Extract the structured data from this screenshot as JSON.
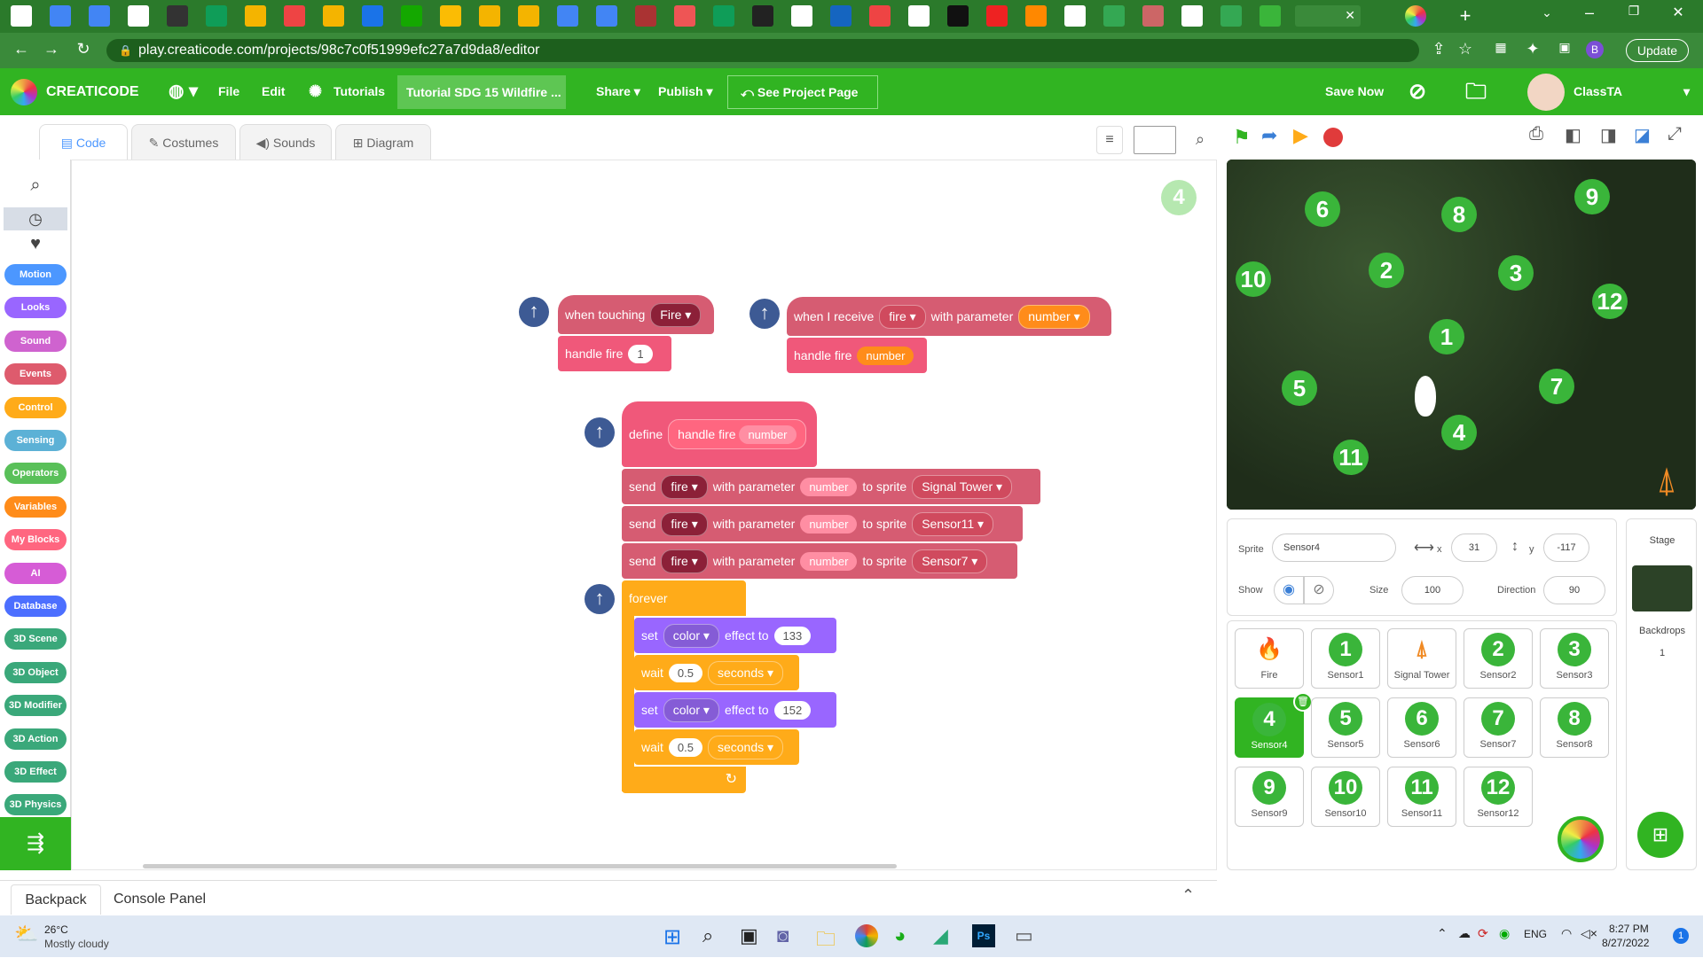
{
  "browser": {
    "url": "play.creaticode.com/projects/98c7c0f51999efc27a7d9da8/editor",
    "update_label": "Update",
    "profile_initial": "B"
  },
  "app": {
    "brand": "CREATICODE",
    "menu": {
      "file": "File",
      "edit": "Edit",
      "tutorials": "Tutorials",
      "share": "Share",
      "publish": "Publish",
      "see_project": "See Project Page"
    },
    "project_title": "Tutorial SDG 15 Wildfire ...",
    "save_now": "Save Now",
    "user": "ClassTA"
  },
  "tabs": {
    "code": "Code",
    "costumes": "Costumes",
    "sounds": "Sounds",
    "diagram": "Diagram"
  },
  "categories": [
    {
      "label": "Motion",
      "color": "#4c97ff"
    },
    {
      "label": "Looks",
      "color": "#9966ff"
    },
    {
      "label": "Sound",
      "color": "#cf63cf"
    },
    {
      "label": "Events",
      "color": "#de5b6d"
    },
    {
      "label": "Control",
      "color": "#ffab19"
    },
    {
      "label": "Sensing",
      "color": "#5cb1d6"
    },
    {
      "label": "Operators",
      "color": "#59c059"
    },
    {
      "label": "Variables",
      "color": "#ff8c1a"
    },
    {
      "label": "My Blocks",
      "color": "#ff6680"
    },
    {
      "label": "AI",
      "color": "#d65cd6"
    },
    {
      "label": "Database",
      "color": "#4c6fff"
    },
    {
      "label": "3D Scene",
      "color": "#3aa87a"
    },
    {
      "label": "3D Object",
      "color": "#3aa87a"
    },
    {
      "label": "3D Modifier",
      "color": "#3aa87a"
    },
    {
      "label": "3D Action",
      "color": "#3aa87a"
    },
    {
      "label": "3D Effect",
      "color": "#3aa87a"
    },
    {
      "label": "3D Physics",
      "color": "#3aa87a"
    }
  ],
  "code": {
    "sprite_badge": "4",
    "hat1": {
      "text": "when touching",
      "dropdown": "Fire"
    },
    "call1": {
      "text": "handle fire",
      "arg": "1"
    },
    "hat2": {
      "text": "when I receive",
      "dropdown": "fire",
      "with": "with parameter",
      "param": "number"
    },
    "call2": {
      "text": "handle fire",
      "arg": "number"
    },
    "define": {
      "text": "define",
      "name": "handle fire",
      "param": "number"
    },
    "send1": {
      "send": "send",
      "msg": "fire",
      "with": "with parameter",
      "param": "number",
      "to": "to sprite",
      "target": "Signal Tower"
    },
    "send2": {
      "send": "send",
      "msg": "fire",
      "with": "with parameter",
      "param": "number",
      "to": "to sprite",
      "target": "Sensor11"
    },
    "send3": {
      "send": "send",
      "msg": "fire",
      "with": "with parameter",
      "param": "number",
      "to": "to sprite",
      "target": "Sensor7"
    },
    "forever": "forever",
    "set1": {
      "set": "set",
      "effect": "color",
      "to": "effect to",
      "value": "133"
    },
    "wait1": {
      "wait": "wait",
      "value": "0.5",
      "unit": "seconds"
    },
    "set2": {
      "set": "set",
      "effect": "color",
      "to": "effect to",
      "value": "152"
    },
    "wait2": {
      "wait": "wait",
      "value": "0.5",
      "unit": "seconds"
    }
  },
  "bottom": {
    "backpack": "Backpack",
    "console": "Console Panel"
  },
  "stage_numbers": [
    "6",
    "8",
    "9",
    "10",
    "2",
    "3",
    "12",
    "1",
    "5",
    "7",
    "4",
    "11"
  ],
  "sprite_info": {
    "sprite_label": "Sprite",
    "sprite_name": "Sensor4",
    "x_label": "x",
    "x": "31",
    "y_label": "y",
    "y": "-117",
    "show_label": "Show",
    "size_label": "Size",
    "size": "100",
    "direction_label": "Direction",
    "direction": "90"
  },
  "sprites": [
    {
      "name": "Fire",
      "badge": ""
    },
    {
      "name": "Sensor1",
      "badge": "1"
    },
    {
      "name": "Signal Tower",
      "badge": ""
    },
    {
      "name": "Sensor2",
      "badge": "2"
    },
    {
      "name": "Sensor3",
      "badge": "3"
    },
    {
      "name": "Sensor4",
      "badge": "4"
    },
    {
      "name": "Sensor5",
      "badge": "5"
    },
    {
      "name": "Sensor6",
      "badge": "6"
    },
    {
      "name": "Sensor7",
      "badge": "7"
    },
    {
      "name": "Sensor8",
      "badge": "8"
    },
    {
      "name": "Sensor9",
      "badge": "9"
    },
    {
      "name": "Sensor10",
      "badge": "10"
    },
    {
      "name": "Sensor11",
      "badge": "11"
    },
    {
      "name": "Sensor12",
      "badge": "12"
    }
  ],
  "stage_panel": {
    "title": "Stage",
    "backdrops": "Backdrops",
    "count": "1"
  },
  "taskbar": {
    "temp": "26°C",
    "weather": "Mostly cloudy",
    "lang": "ENG",
    "time": "8:27 PM",
    "date": "8/27/2022",
    "notif": "1"
  }
}
